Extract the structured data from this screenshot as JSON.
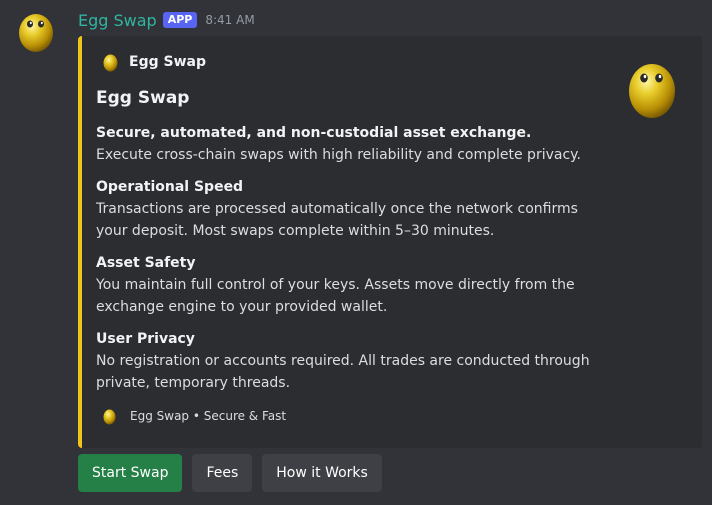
{
  "message": {
    "author": "Egg Swap",
    "badge": "APP",
    "timestamp": "8:41 AM"
  },
  "embed": {
    "accent_color": "#f0c419",
    "author_name": "Egg Swap",
    "title": "Egg Swap",
    "tagline": "Secure, automated, and non-custodial asset exchange.",
    "description": "Execute cross-chain swaps with high reliability and complete privacy.",
    "fields": [
      {
        "name": "Operational Speed",
        "value": "Transactions are processed automatically once the network confirms your deposit. Most swaps complete within 5–30 minutes."
      },
      {
        "name": "Asset Safety",
        "value": "You maintain full control of your keys. Assets move directly from the exchange engine to your provided wallet."
      },
      {
        "name": "User Privacy",
        "value": "No registration or accounts required. All trades are conducted through private, temporary threads."
      }
    ],
    "footer": "Egg Swap • Secure & Fast"
  },
  "buttons": {
    "start": "Start Swap",
    "fees": "Fees",
    "how": "How it Works"
  },
  "icons": {
    "avatar": "golden-egg-icon",
    "thumbnail": "golden-egg-icon"
  }
}
